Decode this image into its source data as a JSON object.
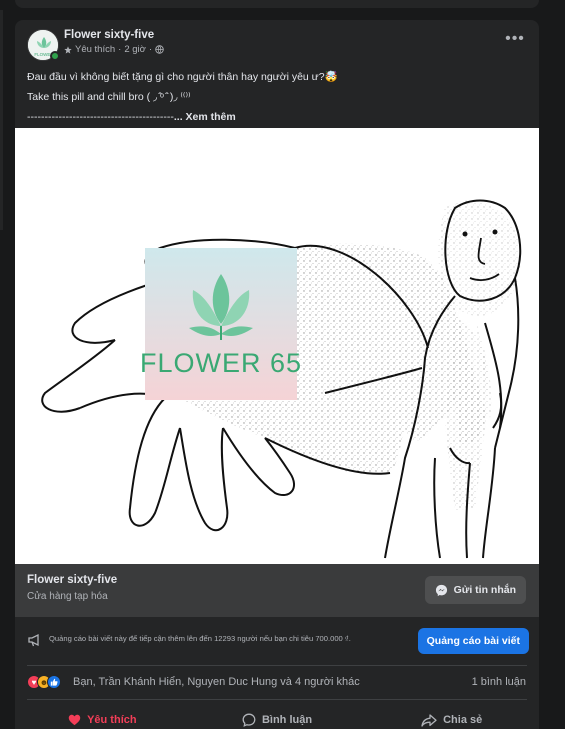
{
  "post": {
    "page_name": "Flower sixty-five",
    "meta_liked": "Yêu thích",
    "meta_time": "2 giờ",
    "more_label": "•••",
    "text_lines": [
      "Đau đầu vì không biết tặng gì cho người thân hay người yêu ư?🤯",
      "Take this pill and chill bro ( ◞ ̑̑ᵒ ̑̑ )◞ ⁽⁽⁾⁾",
      "------------------------------------------"
    ],
    "see_more": "... Xem thêm",
    "logo_text": "FLOWER 65",
    "avatar_text": "FLOWER"
  },
  "cta": {
    "name": "Flower sixty-five",
    "category": "Cửa hàng tạp hóa",
    "message_button": "Gửi tin nhắn"
  },
  "boost": {
    "text": "Quảng cáo bài viết này để tiếp cận thêm lên đến 12293 người nếu bạn chi tiêu 700.000 ₫.",
    "button": "Quảng cáo bài viết"
  },
  "reactions": {
    "names": "Bạn, Trần Khánh Hiển, Nguyen Duc Hung và 4 người khác",
    "comments": "1 bình luận"
  },
  "actions": {
    "like": "Yêu thích",
    "comment": "Bình luận",
    "share": "Chia sẻ"
  },
  "colors": {
    "background": "#18191a",
    "card": "#242526",
    "accent": "#1b74e4",
    "love": "#f33e58",
    "logo_green": "#3aa873"
  }
}
